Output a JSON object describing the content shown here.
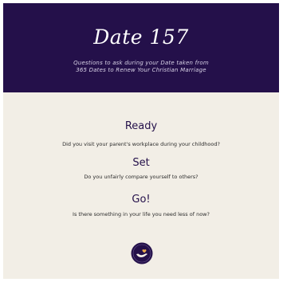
{
  "header": {
    "title": "Date 157",
    "subtitle_line1": "Questions to ask during your Date taken from",
    "subtitle_line2": "365 Dates to Renew Your Christian Marriage"
  },
  "sections": [
    {
      "heading": "Ready",
      "question": "Did you visit your parent's workplace during your childhood?"
    },
    {
      "heading": "Set",
      "question": "Do you unfairly compare yourself to others?"
    },
    {
      "heading": "Go!",
      "question": "Is there something in your life you need less of now?"
    }
  ],
  "logo": {
    "icon": "hands-heart-icon"
  },
  "colors": {
    "header_bg": "#24104a",
    "body_bg": "#f2eee6",
    "accent": "#e7a94b"
  }
}
